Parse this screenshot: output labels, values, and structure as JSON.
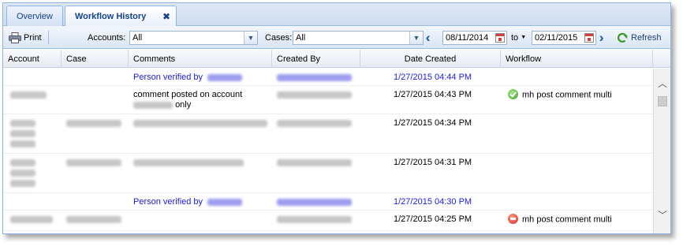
{
  "tabs": [
    {
      "label": "Overview",
      "active": false
    },
    {
      "label": "Workflow History",
      "active": true
    }
  ],
  "tab_close_glyph": "✖",
  "toolbar": {
    "print_label": "Print",
    "accounts_label": "Accounts:",
    "accounts_value": "All",
    "cases_label": "Cases:",
    "cases_value": "All",
    "date_from": "08/11/2014",
    "to_label": "to",
    "date_to": "02/11/2015",
    "refresh_label": "Refresh"
  },
  "grid": {
    "columns": [
      "Account",
      "Case",
      "Comments",
      "Created By",
      "Date Created",
      "Workflow"
    ],
    "rows": [
      {
        "type": "verified",
        "comment_prefix": "Person verified by",
        "date": "1/27/2015 04:44 PM"
      },
      {
        "type": "entry",
        "comment_line1": "comment posted on account",
        "comment_line2_suffix": "only",
        "date": "1/27/2015 04:43 PM",
        "workflow": "mh post comment multi",
        "workflow_icon": "ok"
      },
      {
        "type": "entry",
        "date": "1/27/2015 04:34 PM"
      },
      {
        "type": "entry",
        "date": "1/27/2015 04:31 PM"
      },
      {
        "type": "verified",
        "comment_prefix": "Person verified by",
        "date": "1/27/2015 04:30 PM"
      },
      {
        "type": "entry",
        "date": "1/27/2015 04:25 PM",
        "workflow": "mh post comment multi",
        "workflow_icon": "stop"
      }
    ]
  },
  "colors": {
    "link_blue": "#1c1cdc",
    "tab_text": "#15428b",
    "border": "#8db2e3"
  },
  "icons": [
    "printer-icon",
    "close-icon",
    "calendar-icon",
    "double-chevron-left-icon",
    "double-chevron-right-icon",
    "refresh-icon",
    "check-circle-icon",
    "stop-circle-icon"
  ]
}
